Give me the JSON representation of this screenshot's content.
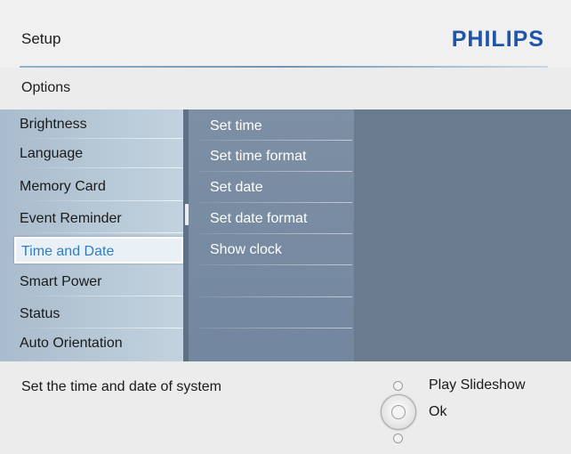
{
  "header": {
    "title": "Setup",
    "brand": "PHILIPS"
  },
  "section": {
    "title": "Options"
  },
  "menu": {
    "items": [
      "Brightness",
      "Language",
      "Memory Card",
      "Event Reminder",
      "Time and Date",
      "Smart Power",
      "Status",
      "Auto Orientation"
    ],
    "selected": "Time and Date"
  },
  "submenu": {
    "items": [
      "Set time",
      "Set time format",
      "Set date",
      "Set date format",
      "Show clock"
    ]
  },
  "footer": {
    "description": "Set the time and date of system",
    "controls": {
      "up_label": "Play Slideshow",
      "ok_label": "Ok"
    }
  },
  "colors": {
    "brand": "#1f55a8",
    "selected_text": "#2f7ec4",
    "panel_dark": "#6b7b8e",
    "submenu_bg": "#7a8da2"
  },
  "icons": [
    "control-up-dot-icon",
    "ok-button-icon",
    "control-down-dot-icon"
  ]
}
